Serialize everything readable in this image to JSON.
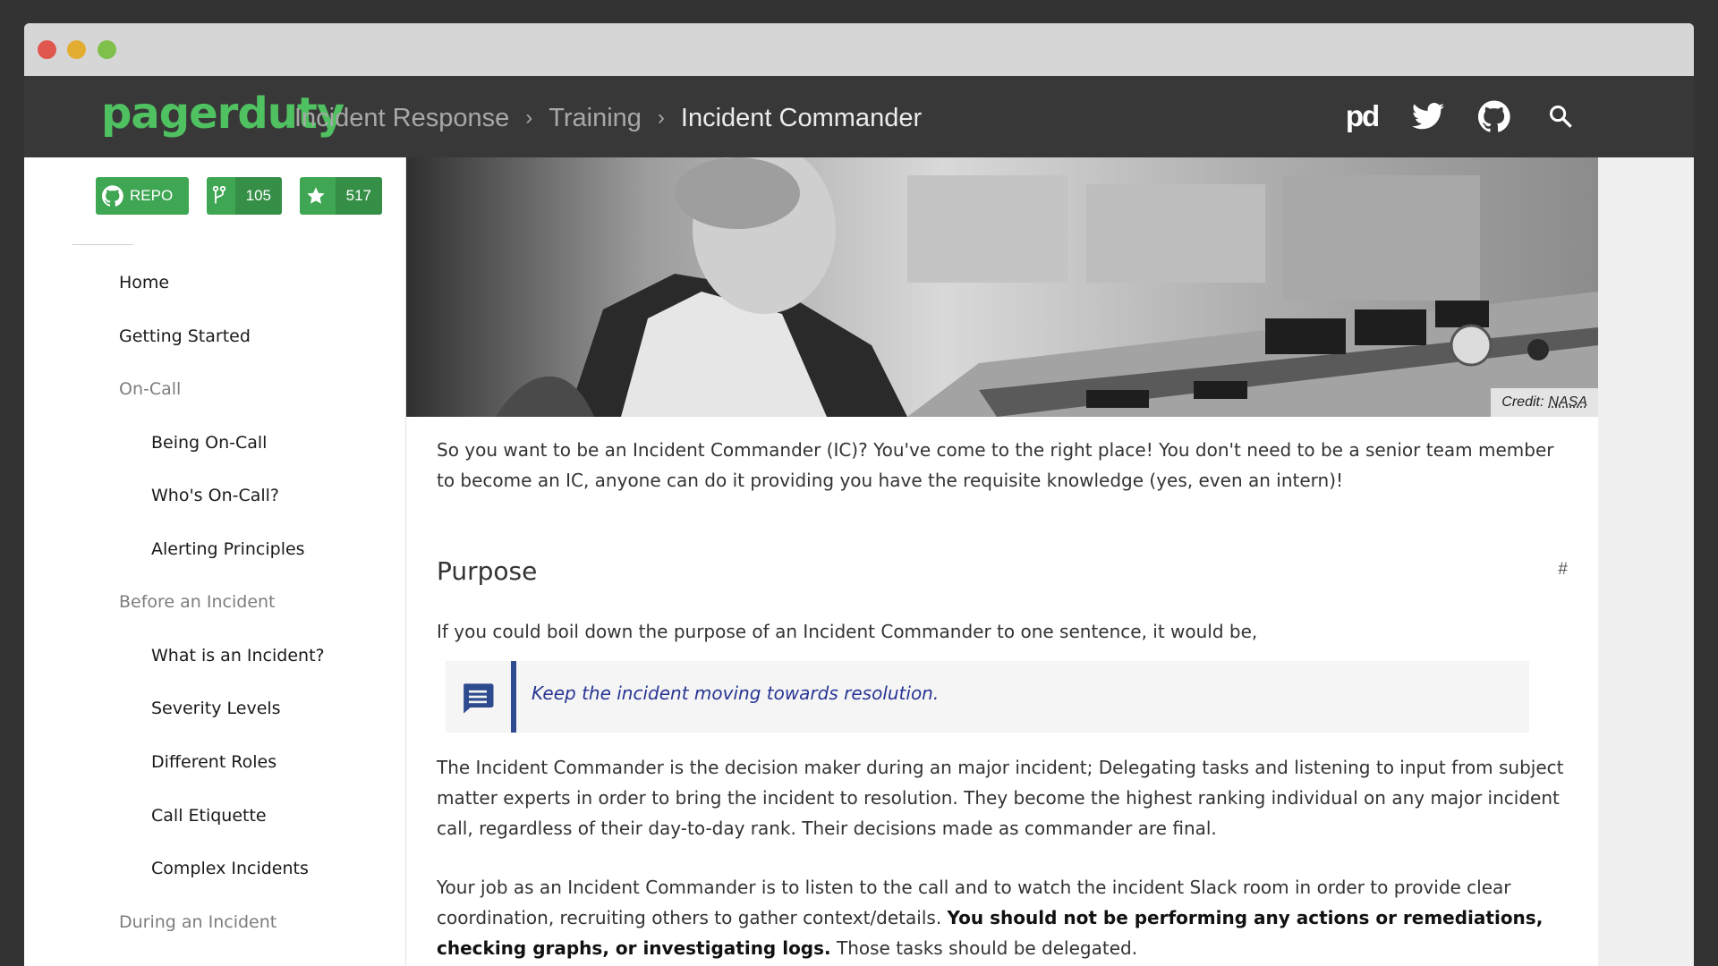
{
  "header": {
    "logo": "pagerduty",
    "breadcrumbs": [
      "Incident Response",
      "Training",
      "Incident Commander"
    ],
    "icons": [
      "pagerduty-icon",
      "twitter-icon",
      "github-icon",
      "search-icon"
    ],
    "pd_mark": "pd"
  },
  "sidebar": {
    "badges": {
      "repo": "REPO",
      "forks": "105",
      "stars": "517"
    },
    "nav": [
      {
        "label": "Home",
        "level": 1
      },
      {
        "label": "Getting Started",
        "level": 1
      },
      {
        "label": "On-Call",
        "level": 1,
        "section": true
      },
      {
        "label": "Being On-Call",
        "level": 2
      },
      {
        "label": "Who's On-Call?",
        "level": 2
      },
      {
        "label": "Alerting Principles",
        "level": 2
      },
      {
        "label": "Before an Incident",
        "level": 1,
        "section": true
      },
      {
        "label": "What is an Incident?",
        "level": 2
      },
      {
        "label": "Severity Levels",
        "level": 2
      },
      {
        "label": "Different Roles",
        "level": 2
      },
      {
        "label": "Call Etiquette",
        "level": 2
      },
      {
        "label": "Complex Incidents",
        "level": 2
      },
      {
        "label": "During an Incident",
        "level": 1,
        "section": true
      }
    ]
  },
  "content": {
    "credit_label": "Credit:",
    "credit_source": "NASA",
    "intro": "So you want to be an Incident Commander (IC)? You've come to the right place! You don't need to be a senior team member to become an IC, anyone can do it providing you have the requisite knowledge (yes, even an intern)!",
    "purpose_heading": "Purpose",
    "anchor": "#",
    "purpose_lead": "If you could boil down the purpose of an Incident Commander to one sentence, it would be,",
    "quote": "Keep the incident moving towards resolution.",
    "para1": "The Incident Commander is the decision maker during an major incident; Delegating tasks and listening to input from subject matter experts in order to bring the incident to resolution. They become the highest ranking individual on any major incident call, regardless of their day-to-day rank. Their decisions made as commander are final.",
    "para2_start": "Your job as an Incident Commander is to listen to the call and to watch the incident Slack room in order to provide clear coordination, recruiting others to gather context/details. ",
    "para2_bold": "You should not be performing any actions or remediations, checking graphs, or investigating logs.",
    "para2_end": " Those tasks should be delegated."
  },
  "colors": {
    "brand_green": "#4fc160",
    "badge_green": "#3fa653",
    "quote_accent": "#2d4b8e",
    "header_bg": "#383838"
  }
}
